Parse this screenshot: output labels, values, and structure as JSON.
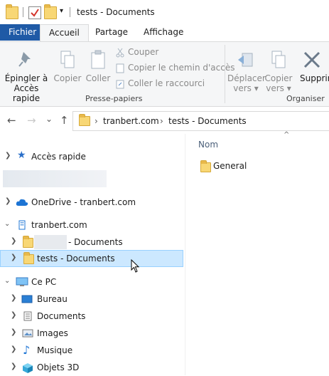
{
  "window": {
    "title": "tests - Documents"
  },
  "tabs": {
    "fichier": "Fichier",
    "accueil": "Accueil",
    "partage": "Partage",
    "affichage": "Affichage"
  },
  "ribbon": {
    "pin_line1": "Épingler à",
    "pin_line2": "Accès rapide",
    "copy": "Copier",
    "paste": "Coller",
    "cut": "Couper",
    "copy_path": "Copier le chemin d'accès",
    "paste_shortcut": "Coller le raccourci",
    "group_clipboard": "Presse-papiers",
    "move_line1": "Déplacer",
    "move_line2": "vers ▾",
    "copyto_line1": "Copier",
    "copyto_line2": "vers ▾",
    "delete": "Supprim",
    "group_organize": "Organiser"
  },
  "address": {
    "back": "←",
    "forward": "→",
    "recent": "⌄",
    "up": "↑",
    "crumbs": [
      "tranbert.com",
      "tests - Documents"
    ],
    "sep": "›"
  },
  "nav": {
    "quick_access": "Accès rapide",
    "onedrive": "OneDrive - tranbert.com",
    "org": "tranbert.com",
    "hidden_docs": "- Documents",
    "tests_docs": "tests - Documents",
    "this_pc": "Ce PC",
    "desktop": "Bureau",
    "documents": "Documents",
    "images": "Images",
    "music": "Musique",
    "objects3d": "Objets 3D"
  },
  "content": {
    "column_name": "Nom",
    "sort_indicator": "^",
    "items": [
      "General"
    ]
  },
  "colors": {
    "accent": "#1f5aa6",
    "selection": "#cce8ff",
    "folder": "#f8d775"
  }
}
